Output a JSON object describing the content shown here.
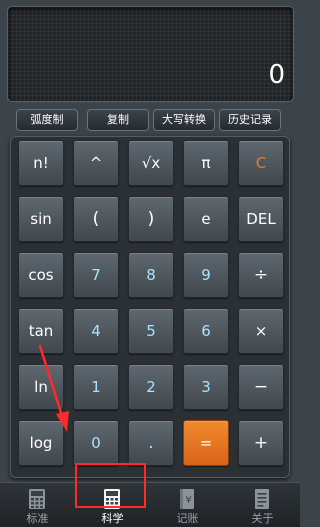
{
  "display": {
    "value": "0"
  },
  "function_buttons": [
    {
      "label": "弧度制"
    },
    {
      "label": "复制"
    },
    {
      "label": "大写转换"
    },
    {
      "label": "历史记录"
    }
  ],
  "keys": {
    "factorial": "n!",
    "power": "^",
    "sqrt": "√x",
    "pi": "π",
    "clear": "C",
    "sin": "sin",
    "open_paren": "(",
    "close_paren": ")",
    "e": "e",
    "delete": "DEL",
    "cos": "cos",
    "seven": "7",
    "eight": "8",
    "nine": "9",
    "divide": "÷",
    "tan": "tan",
    "four": "4",
    "five": "5",
    "six": "6",
    "multiply": "×",
    "ln": "ln",
    "one": "1",
    "two": "2",
    "three": "3",
    "minus": "−",
    "log": "log",
    "zero": "0",
    "dot": ".",
    "equals": "=",
    "plus": "+"
  },
  "tabs": [
    {
      "label": "标准",
      "icon": "calculator-icon",
      "active": false
    },
    {
      "label": "科学",
      "icon": "scientific-calculator-icon",
      "active": true
    },
    {
      "label": "记账",
      "icon": "ledger-icon",
      "active": false
    },
    {
      "label": "关于",
      "icon": "info-document-icon",
      "active": false
    }
  ],
  "annotation_colors": {
    "highlight": "#ff2a2a",
    "accent_orange": "#f07a2a",
    "digit_cyan": "#a9e3ff"
  }
}
